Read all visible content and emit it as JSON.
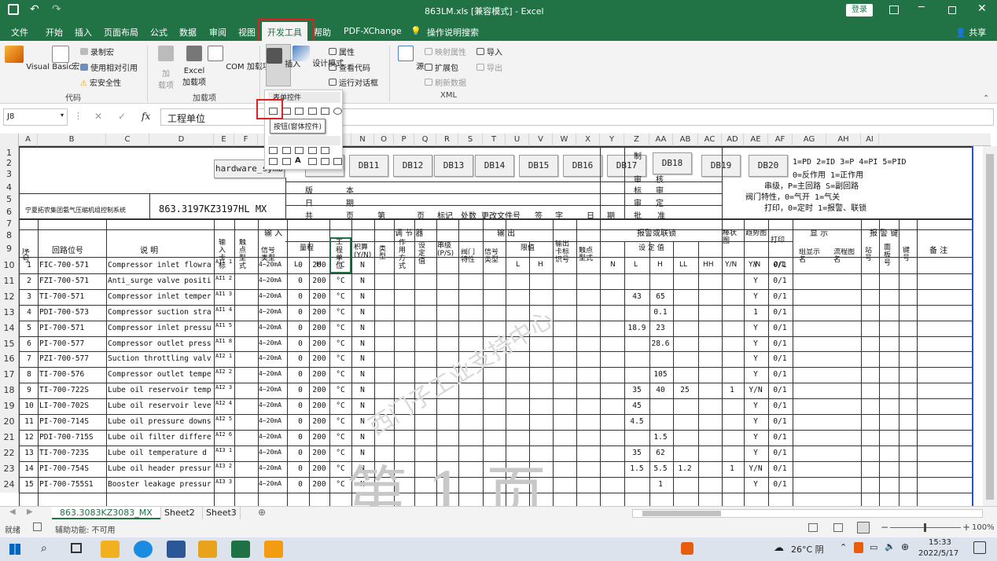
{
  "window": {
    "title": "863LM.xls [兼容模式] - Excel",
    "login": "登录"
  },
  "menu": {
    "tabs": [
      "文件",
      "开始",
      "插入",
      "页面布局",
      "公式",
      "数据",
      "审阅",
      "视图",
      "开发工具",
      "帮助",
      "PDF-XChange",
      "操作说明搜索"
    ],
    "share": "共享"
  },
  "ribbon": {
    "code": {
      "vb": "Visual Basic",
      "macro": "宏",
      "record": "录制宏",
      "relative": "使用相对引用",
      "security": "宏安全性",
      "group": "代码"
    },
    "addins": {
      "add": "加",
      "add2": "载项",
      "excel": "Excel",
      "excel2": "加载项",
      "com": "COM 加载项",
      "group": "加载项"
    },
    "controls": {
      "insert": "插入",
      "design": "设计模式",
      "props": "属性",
      "viewcode": "查看代码",
      "dialog": "运行对话框"
    },
    "xml": {
      "source": "源",
      "map": "映射属性",
      "expand": "扩展包",
      "refresh": "刷新数据",
      "import": "导入",
      "export": "导出",
      "group": "XML"
    }
  },
  "formula": {
    "namebox": "J8",
    "fx": "fx",
    "content": "工程单位"
  },
  "popup": {
    "heading": "表单控件",
    "tooltip": "按钮(窗体控件)"
  },
  "columns": [
    "A",
    "B",
    "C",
    "D",
    "E",
    "F",
    "I",
    "K",
    "L",
    "M",
    "N",
    "O",
    "P",
    "Q",
    "R",
    "S",
    "T",
    "U",
    "V",
    "W",
    "X",
    "Y",
    "Z",
    "AA",
    "AB",
    "AC",
    "AD",
    "AE",
    "AF",
    "AG",
    "AH",
    "AI"
  ],
  "rows": [
    "1",
    "2",
    "3",
    "4",
    "5",
    "6",
    "7",
    "8",
    "9",
    "10",
    "11",
    "12",
    "13",
    "14",
    "15",
    "16",
    "17",
    "18",
    "19",
    "20",
    "21",
    "22",
    "23",
    "24"
  ],
  "sheet": {
    "hwbtn": "hardware_symb",
    "dbbuttons": [
      "DB11",
      "DB12",
      "DB13",
      "DB14",
      "DB15",
      "DB16",
      "DB17",
      "DB18",
      "DB19",
      "DB20"
    ],
    "company": "宁夏拓农集团氨气压缩机组控制系统",
    "drawing": "863.3197KZ3197HL MX",
    "tb_ban": "版",
    "tb_ben": "本",
    "tb_ri": "日",
    "tb_qi": "期",
    "tb_gong": "共",
    "tb_ye": "页",
    "tb_di": "第",
    "tb_ye2": "页",
    "tb_mark": "标记",
    "tb_count": "处数",
    "tb_change": "更改文件号",
    "tb_sign": "签",
    "tb_zi": "字",
    "tb_date": "日",
    "tb_qi2": "期",
    "tb_pi": "批",
    "tb_zhun": "准",
    "tb_shen": "审",
    "tb_he": "核",
    "tb_biao": "标",
    "tb_shen2": "审",
    "tb_shending": "审",
    "tb_ding": "定",
    "tb_zhi": "制",
    "note1": "1=PD 2=ID 3=P 4=PI 5=PID",
    "note2": "0=反作用 1=正作用",
    "note3": "串级，P=主回路 S=副回路",
    "note4": "阀门特性，0=气开  1=气关",
    "note5": "打印，0=定时  1=报警、联锁",
    "hdr_seq": "序号",
    "hdr_loop": "回路位号",
    "hdr_desc": "说    明",
    "hdr_input": "输        入",
    "hdr_reg": "调  节  器",
    "hdr_output": "输              出",
    "hdr_alarm": "报警或联锁",
    "hdr_bar": "棒状图",
    "hdr_trend": "趋势图",
    "hdr_print": "打印",
    "hdr_display": "显  示",
    "hdr_alarmkey": "报  警  键",
    "hdr_remark": "备   注",
    "hdr_incard": "输入卡标",
    "hdr_ctype": "触点型式",
    "hdr_sig": "信号类型",
    "hdr_range": "量程",
    "hdr_unit": "工程单位",
    "hdr_integ": "积算(Y/N)",
    "hdr_type": "类型",
    "hdr_act": "作用方式",
    "hdr_set": "设定值",
    "hdr_cascade": "串级(P/S)",
    "hdr_valve": "阀门特性",
    "hdr_outsig": "信号类型",
    "hdr_limit": "限值",
    "hdr_outcard": "输出卡标识号",
    "hdr_contact": "触点型式",
    "hdr_setval": "设  定  值",
    "hdr_grp": "组显示名",
    "hdr_flow": "流程图名",
    "hdr_station": "站号",
    "hdr_panel": "面板号",
    "hdr_key": "键号",
    "sub_L": "L",
    "sub_H": "H",
    "sub_L2": "L",
    "sub_H2": "H",
    "sub_N": "N",
    "sub_AL": "L",
    "sub_AH": "H",
    "sub_LL": "LL",
    "sub_HH": "HH",
    "sub_YN": "Y/N",
    "sub_YN2": "Y/N",
    "sub_01": "0/1",
    "rows": [
      {
        "n": "1",
        "tag": "FIC-700-571",
        "desc": "Compressor inlet flowra",
        "card": "AI1 1",
        "sig": "4~20mA",
        "lo": "0",
        "hi": "200",
        "unit": "°C",
        "int": "N",
        "L": "",
        "H": "",
        "LL": "",
        "bar": "",
        "trend": "Y",
        "print": "0/1"
      },
      {
        "n": "2",
        "tag": "FZI-700-571",
        "desc": "Anti_surge valve positi",
        "card": "AI1 2",
        "sig": "4~20mA",
        "lo": "0",
        "hi": "200",
        "unit": "°C",
        "int": "N",
        "L": "",
        "H": "",
        "LL": "",
        "bar": "",
        "trend": "Y",
        "print": "0/1"
      },
      {
        "n": "3",
        "tag": "TI-700-571",
        "desc": "Compressor inlet temper",
        "card": "AI1 3",
        "sig": "4~20mA",
        "lo": "0",
        "hi": "200",
        "unit": "°C",
        "int": "N",
        "L": "43",
        "H": "65",
        "LL": "",
        "bar": "",
        "trend": "Y",
        "print": "0/1"
      },
      {
        "n": "4",
        "tag": "PDI-700-573",
        "desc": "Compressor suction stra",
        "card": "AI1 4",
        "sig": "4~20mA",
        "lo": "0",
        "hi": "200",
        "unit": "°C",
        "int": "N",
        "L": "",
        "H": "0.1",
        "LL": "",
        "bar": "",
        "trend": "1",
        "print": "0/1"
      },
      {
        "n": "5",
        "tag": "PI-700-571",
        "desc": "Compressor inlet pressu",
        "card": "AI1 5",
        "sig": "4~20mA",
        "lo": "0",
        "hi": "200",
        "unit": "°C",
        "int": "N",
        "L": "18.9",
        "H": "23",
        "LL": "",
        "bar": "",
        "trend": "Y",
        "print": "0/1"
      },
      {
        "n": "6",
        "tag": "PI-700-577",
        "desc": "Compressor outlet press",
        "card": "AI1 8",
        "sig": "4~20mA",
        "lo": "0",
        "hi": "200",
        "unit": "°C",
        "int": "N",
        "L": "",
        "H": "28.6",
        "LL": "",
        "bar": "",
        "trend": "Y",
        "print": "0/1"
      },
      {
        "n": "7",
        "tag": "PZI-700-577",
        "desc": "Suction throttling valv",
        "card": "AI2 1",
        "sig": "4~20mA",
        "lo": "0",
        "hi": "200",
        "unit": "°C",
        "int": "N",
        "L": "",
        "H": "",
        "LL": "",
        "bar": "",
        "trend": "Y",
        "print": "0/1"
      },
      {
        "n": "8",
        "tag": "TI-700-576",
        "desc": "Compressor outlet tempe",
        "card": "AI2 2",
        "sig": "4~20mA",
        "lo": "0",
        "hi": "200",
        "unit": "°C",
        "int": "N",
        "L": "",
        "H": "105",
        "LL": "",
        "bar": "",
        "trend": "Y",
        "print": "0/1"
      },
      {
        "n": "9",
        "tag": "TI-700-722S",
        "desc": "Lube oil reservoir temp",
        "card": "AI2 3",
        "sig": "4~20mA",
        "lo": "0",
        "hi": "200",
        "unit": "°C",
        "int": "N",
        "L": "35",
        "H": "40",
        "LL": "25",
        "bar": "1",
        "trend": "Y/N",
        "print": "0/1"
      },
      {
        "n": "10",
        "tag": "LI-700-702S",
        "desc": "Lube oil reservoir leve",
        "card": "AI2 4",
        "sig": "4~20mA",
        "lo": "0",
        "hi": "200",
        "unit": "°C",
        "int": "N",
        "L": "45",
        "H": "",
        "LL": "",
        "bar": "",
        "trend": "Y",
        "print": "0/1"
      },
      {
        "n": "11",
        "tag": "PI-700-714S",
        "desc": "Lube oil pressure downs",
        "card": "AI2 5",
        "sig": "4~20mA",
        "lo": "0",
        "hi": "200",
        "unit": "°C",
        "int": "N",
        "L": "4.5",
        "H": "",
        "LL": "",
        "bar": "",
        "trend": "Y",
        "print": "0/1"
      },
      {
        "n": "12",
        "tag": "PDI-700-715S",
        "desc": "Lube oil filter differe",
        "card": "AI2 6",
        "sig": "4~20mA",
        "lo": "0",
        "hi": "200",
        "unit": "°C",
        "int": "N",
        "L": "",
        "H": "1.5",
        "LL": "",
        "bar": "",
        "trend": "Y",
        "print": "0/1"
      },
      {
        "n": "13",
        "tag": "TI-700-723S",
        "desc": "Lube oil  temperature d",
        "card": "AI3 1",
        "sig": "4~20mA",
        "lo": "0",
        "hi": "200",
        "unit": "°C",
        "int": "N",
        "L": "35",
        "H": "62",
        "LL": "",
        "bar": "",
        "trend": "Y",
        "print": "0/1"
      },
      {
        "n": "14",
        "tag": "PI-700-754S",
        "desc": "Lube oil header pressur",
        "card": "AI3 2",
        "sig": "4~20mA",
        "lo": "0",
        "hi": "200",
        "unit": "°C",
        "int": "N",
        "L": "1.5",
        "H": "5.5",
        "LL": "1.2",
        "bar": "1",
        "trend": "Y/N",
        "print": "0/1"
      },
      {
        "n": "15",
        "tag": "PI-700-755S1",
        "desc": "Booster leakage pressur",
        "card": "AI3 3",
        "sig": "4~20mA",
        "lo": "0",
        "hi": "200",
        "unit": "°C",
        "int": "N",
        "L": "",
        "H": "1",
        "LL": "",
        "bar": "",
        "trend": "Y",
        "print": "0/1"
      }
    ],
    "watermark_page": "第  1  页",
    "watermark_text": "西门子工业支持中心"
  },
  "sheettabs": [
    "863.3083KZ3083_MX",
    "Sheet2",
    "Sheet3"
  ],
  "status": {
    "ready": "就绪",
    "access": "辅助功能: 不可用",
    "zoom": "100%"
  },
  "taskbar": {
    "weather": "26°C 阴",
    "time": "15:33",
    "date": "2022/5/17"
  }
}
